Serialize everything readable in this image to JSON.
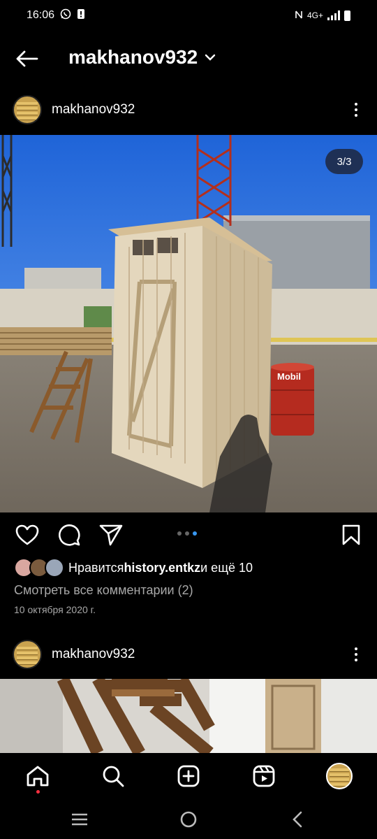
{
  "status": {
    "time": "16:06",
    "network": "4G+"
  },
  "header": {
    "title": "makhanov932"
  },
  "post1": {
    "username": "makhanov932",
    "counter": "3/3",
    "barrel_brand": "Mobil",
    "likes_prefix": "Нравится ",
    "likes_user": "history.entkz",
    "likes_suffix": " и ещё 10",
    "comments_link": "Смотреть все комментарии (2)",
    "date": "10 октября 2020 г.",
    "carousel_total": 3,
    "carousel_active": 3
  },
  "post2": {
    "username": "makhanov932"
  },
  "icons": {
    "back": "arrow-left-icon",
    "dropdown": "chevron-down-icon",
    "more": "more-vertical-icon",
    "like": "heart-icon",
    "comment": "comment-icon",
    "share": "send-icon",
    "save": "bookmark-icon",
    "home": "home-icon",
    "search": "search-icon",
    "create": "plus-square-icon",
    "reels": "reels-icon"
  },
  "colors": {
    "background": "#000000",
    "muted_text": "#a8a8a8",
    "accent_blue": "#3897f0",
    "notification_red": "#ff3040"
  }
}
